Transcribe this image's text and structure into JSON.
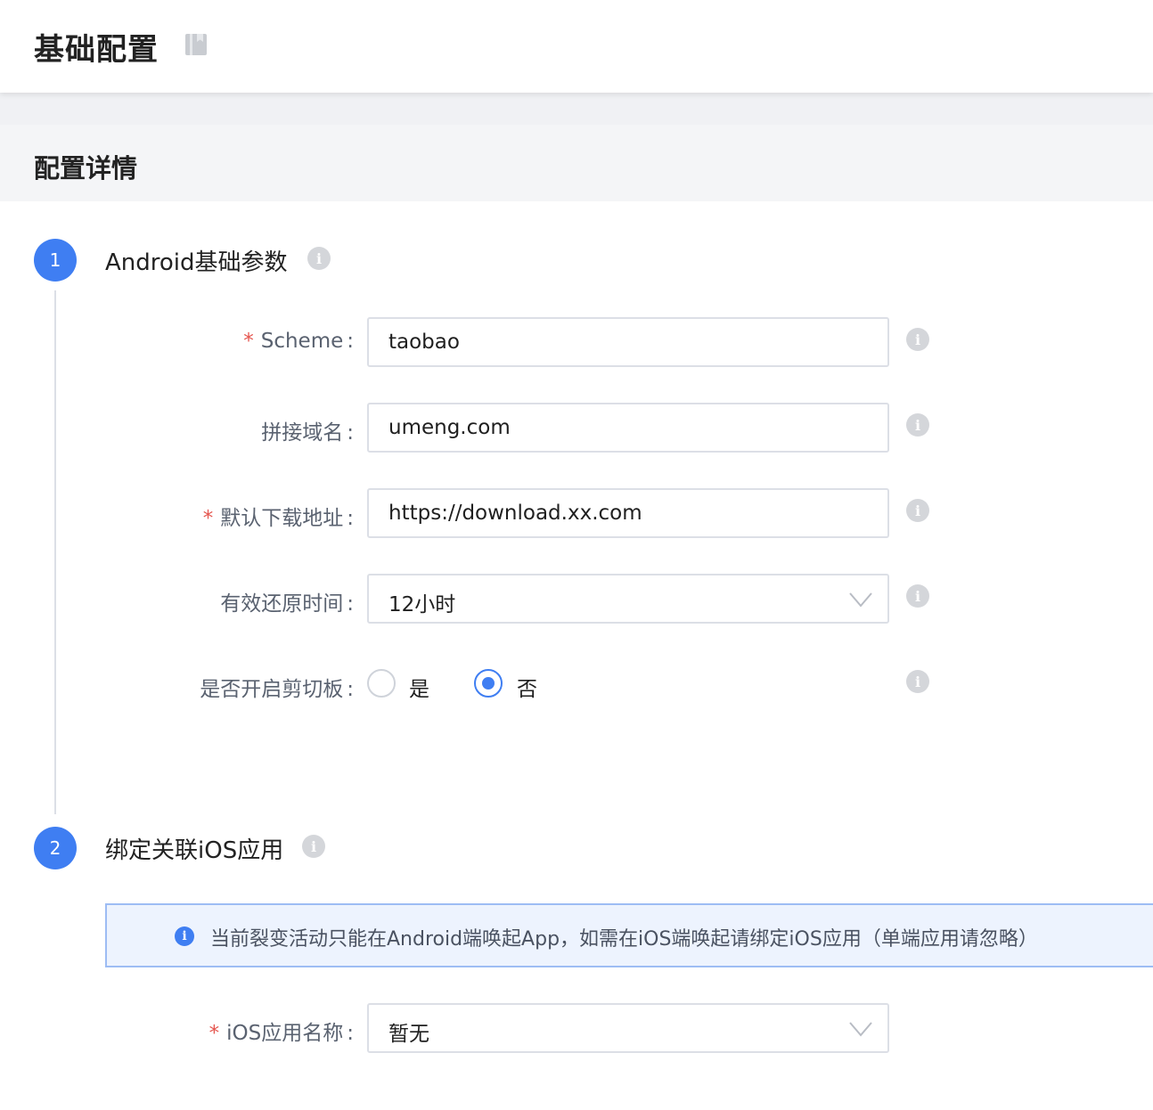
{
  "header": {
    "title": "基础配置",
    "bookmark_icon": "book-icon"
  },
  "section": {
    "title": "配置详情"
  },
  "steps": [
    {
      "number": "1",
      "title": "Android基础参数"
    },
    {
      "number": "2",
      "title": "绑定关联iOS应用"
    }
  ],
  "android_form": {
    "scheme": {
      "required": "*",
      "label": "Scheme",
      "colon": ":",
      "value": "taobao"
    },
    "domain": {
      "label": "拼接域名",
      "colon": ":",
      "value": "umeng.com"
    },
    "download": {
      "required": "*",
      "label": "默认下载地址",
      "colon": ":",
      "value": "https://download.xx.com"
    },
    "restore_time": {
      "label": "有效还原时间",
      "colon": ":",
      "value": "12小时"
    },
    "clipboard": {
      "label": "是否开启剪切板",
      "colon": ":",
      "option_yes": "是",
      "option_no": "否",
      "selected": "否"
    }
  },
  "ios_section": {
    "alert_text": "当前裂变活动只能在Android端唤起App，如需在iOS端唤起请绑定iOS应用（单端应用请忽略）",
    "app_name": {
      "required": "*",
      "label": "iOS应用名称",
      "colon": ":",
      "value": "暂无"
    }
  },
  "colors": {
    "accent": "#3f7ef2",
    "required": "#e5554e",
    "info_icon": "#d4d6da",
    "alert_bg": "#edf3fe",
    "alert_border": "#9dbcf4"
  }
}
